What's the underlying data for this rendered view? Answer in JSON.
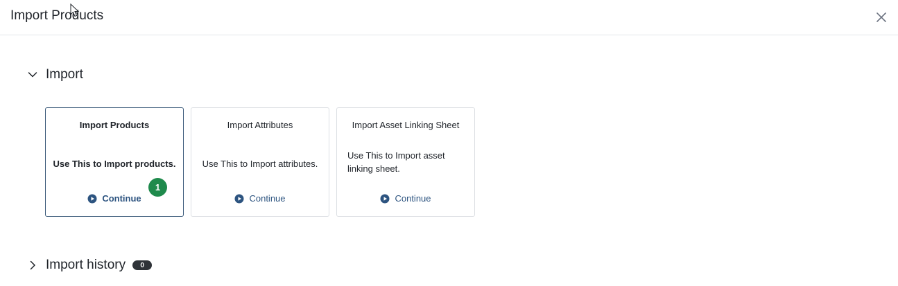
{
  "dialog": {
    "title": "Import Products",
    "close_icon": "close-icon"
  },
  "import_section": {
    "title": "Import",
    "expanded": true,
    "cards": [
      {
        "title": "Import Products",
        "description": "Use This to Import products.",
        "action": "Continue",
        "selected": true,
        "step": "1"
      },
      {
        "title": "Import Attributes",
        "description": "Use This to Import attributes.",
        "action": "Continue",
        "selected": false
      },
      {
        "title": "Import Asset Linking Sheet",
        "description": "Use This to Import asset linking sheet.",
        "action": "Continue",
        "selected": false
      }
    ]
  },
  "history_section": {
    "title": "Import history",
    "count": "0",
    "expanded": false
  },
  "colors": {
    "accent": "#2d5480",
    "step_badge": "#1f8a4c",
    "count_badge": "#2f3338"
  }
}
